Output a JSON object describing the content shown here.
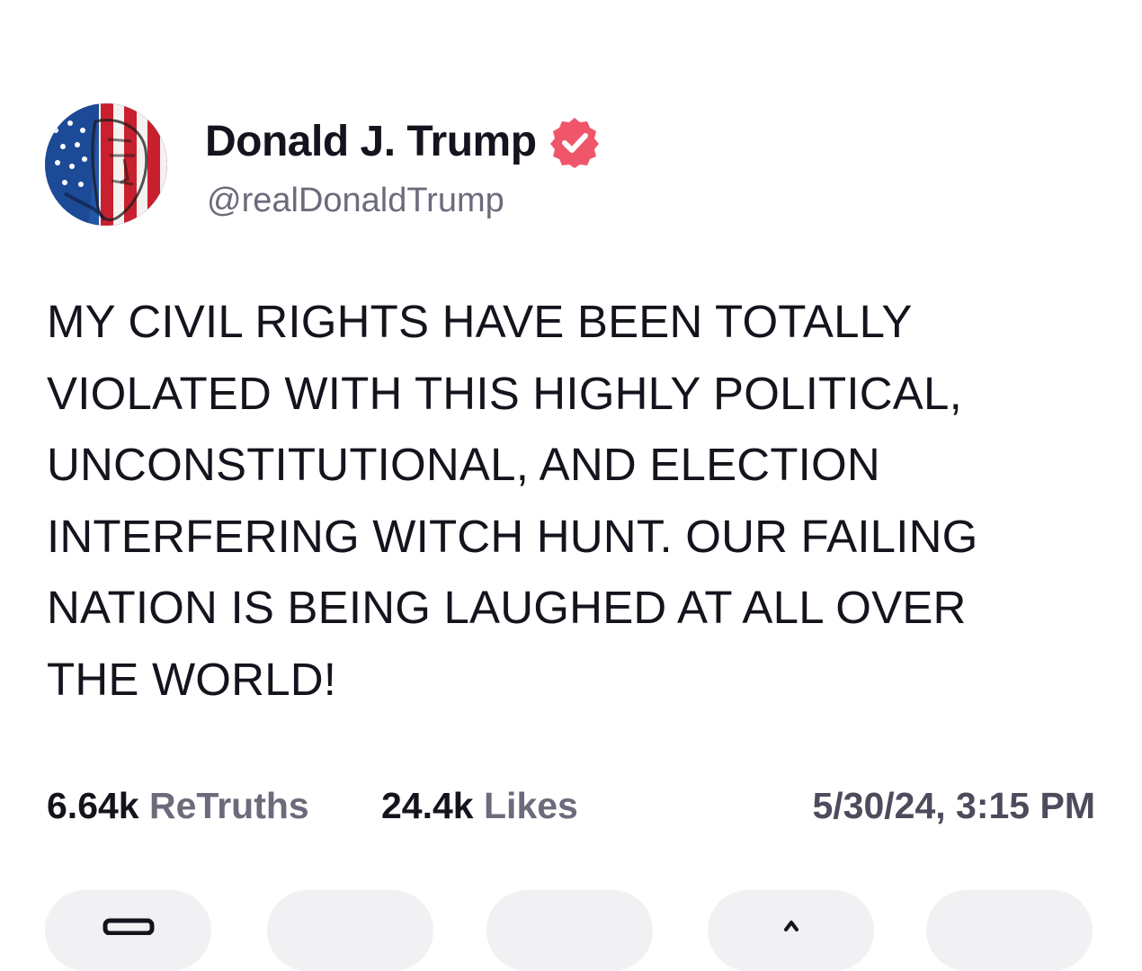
{
  "author": {
    "display_name": "Donald J. Trump",
    "handle": "@realDonaldTrump",
    "verified_icon": "verified-badge-icon",
    "verified_color": "#f0566a"
  },
  "post": {
    "text": "MY CIVIL RIGHTS HAVE BEEN TOTALLY\nVIOLATED WITH THIS HIGHLY POLITICAL,\nUNCONSTITUTIONAL, AND ELECTION\nINTERFERING WITCH HUNT. OUR FAILING\nNATION IS BEING LAUGHED AT ALL OVER\nTHE WORLD!"
  },
  "stats": {
    "retruths_count": "6.64k",
    "retruths_label": "ReTruths",
    "likes_count": "24.4k",
    "likes_label": "Likes",
    "timestamp": "5/30/24, 3:15 PM"
  },
  "actions": [
    {
      "icon": "reply-icon"
    },
    {
      "icon": "retruth-icon"
    },
    {
      "icon": "like-icon"
    },
    {
      "icon": "share-icon"
    },
    {
      "icon": "more-icon"
    }
  ],
  "colors": {
    "text": "#15131c",
    "muted": "#6b6b7c",
    "button_bg": "#f1f1f4"
  }
}
